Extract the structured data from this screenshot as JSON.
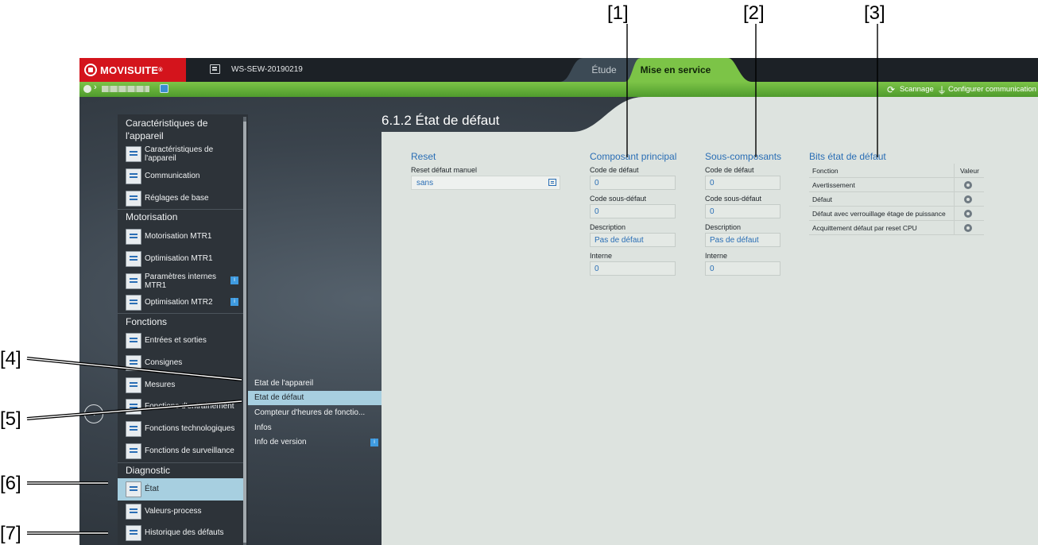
{
  "callouts": [
    "[1]",
    "[2]",
    "[3]",
    "[4]",
    "[5]",
    "[6]",
    "[7]"
  ],
  "titlebar": {
    "logo": "MOVISUITE",
    "logo_mark": "®",
    "workspace": "WS-SEW-20190219",
    "tabs": [
      {
        "label": "Étude",
        "active": false
      },
      {
        "label": "Mise en service",
        "active": true
      }
    ]
  },
  "toolbar": {
    "breadcrumb_sep": "›",
    "scan_label": "Scannage",
    "comm_label": "Configurer communication"
  },
  "sidebar": {
    "groups": [
      {
        "label": "Caractéristiques de l'appareil",
        "items": [
          {
            "label": "Caractéristiques de l'appareil",
            "icon": "device-data-icon"
          },
          {
            "label": "Communication",
            "icon": "network-icon"
          },
          {
            "label": "Réglages de base",
            "icon": "settings-chart-icon"
          }
        ]
      },
      {
        "label": "Motorisation",
        "items": [
          {
            "label": "Motorisation MTR1",
            "icon": "motor-icon"
          },
          {
            "label": "Optimisation MTR1",
            "icon": "motor-icon"
          },
          {
            "label": "Paramètres internes MTR1",
            "icon": "document-icon",
            "badge": "i"
          },
          {
            "label": "Optimisation MTR2",
            "icon": "motor-icon",
            "badge": "i"
          }
        ]
      },
      {
        "label": "Fonctions",
        "items": [
          {
            "label": "Entrées et sorties",
            "icon": "io-icon"
          },
          {
            "label": "Consignes",
            "icon": "setpoint-icon"
          },
          {
            "label": "Mesures",
            "icon": "measure-icon"
          },
          {
            "label": "Fonctions d'entraînement",
            "icon": "drive-icon"
          },
          {
            "label": "Fonctions technologiques",
            "icon": "tech-icon"
          },
          {
            "label": "Fonctions de surveillance",
            "icon": "eye-icon"
          }
        ]
      },
      {
        "label": "Diagnostic",
        "items": [
          {
            "label": "État",
            "icon": "pulse-icon",
            "selected": true
          },
          {
            "label": "Valeurs-process",
            "icon": "process-icon"
          },
          {
            "label": "Historique des défauts",
            "icon": "history-icon"
          }
        ]
      }
    ]
  },
  "submenu": [
    {
      "label": "État de l'appareil"
    },
    {
      "label": "État de défaut",
      "selected": true
    },
    {
      "label": "Compteur d'heures de fonctio..."
    },
    {
      "label": "Infos"
    },
    {
      "label": "Info de version",
      "badge": "i"
    }
  ],
  "content": {
    "page_title": "6.1.2 État de défaut",
    "reset": {
      "title": "Reset",
      "label": "Reset défaut manuel",
      "value": "sans"
    },
    "main_component": {
      "title": "Composant principal",
      "fields": [
        {
          "label": "Code de défaut",
          "value": "0"
        },
        {
          "label": "Code sous-défaut",
          "value": "0"
        },
        {
          "label": "Description",
          "value": "Pas de défaut"
        },
        {
          "label": "Interne",
          "value": "0"
        }
      ]
    },
    "sub_components": {
      "title": "Sous-composants",
      "fields": [
        {
          "label": "Code de défaut",
          "value": "0"
        },
        {
          "label": "Code sous-défaut",
          "value": "0"
        },
        {
          "label": "Description",
          "value": "Pas de défaut"
        },
        {
          "label": "Interne",
          "value": "0"
        }
      ]
    },
    "fault_bits": {
      "title": "Bits état de défaut",
      "col_function": "Fonction",
      "col_value": "Valeur",
      "rows": [
        {
          "label": "Avertissement"
        },
        {
          "label": "Défaut"
        },
        {
          "label": "Défaut avec verrouillage étage de puissance"
        },
        {
          "label": "Acquittement défaut par reset CPU"
        }
      ]
    }
  },
  "colors": {
    "brand_red": "#d4141c",
    "active_green": "#7cc447",
    "accent_blue": "#2a6eb5",
    "selection": "#a7cfe0"
  }
}
